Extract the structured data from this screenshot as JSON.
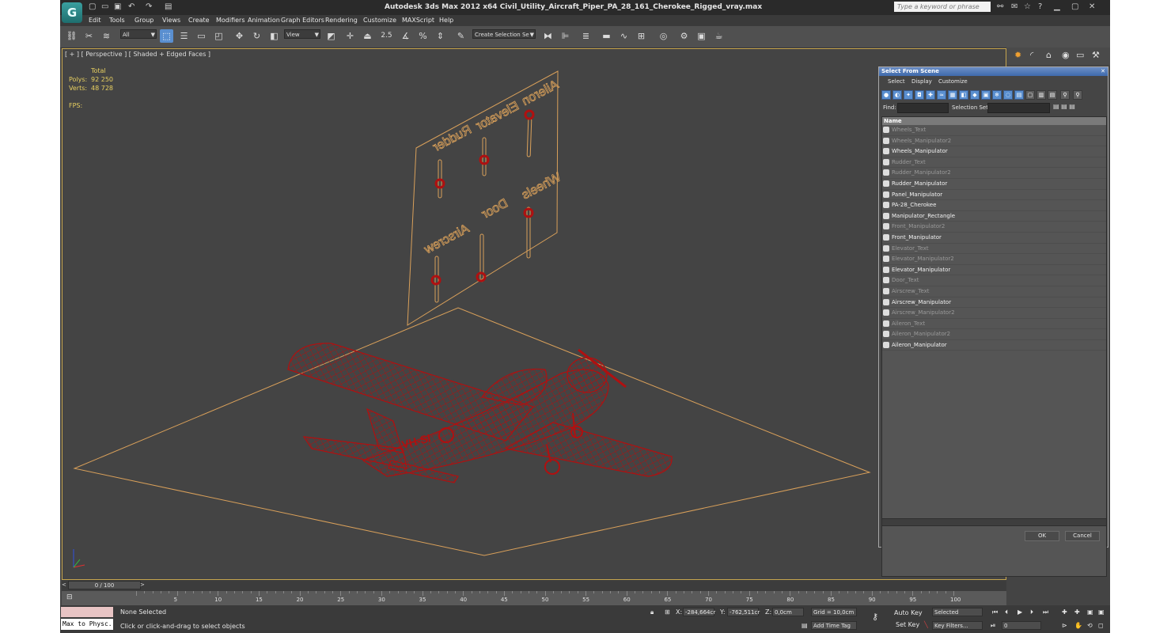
{
  "window": {
    "title": "Autodesk 3ds Max  2012 x64     Civil_Utility_Aircraft_Piper_PA_28_161_Cherokee_Rigged_vray.max",
    "search_placeholder": "Type a keyword or phrase"
  },
  "menu": [
    "Edit",
    "Tools",
    "Group",
    "Views",
    "Create",
    "Modifiers",
    "Animation",
    "Graph Editors",
    "Rendering",
    "Customize",
    "MAXScript",
    "Help"
  ],
  "toolbar": {
    "filter_value": "All",
    "coord_value": "View",
    "selection_set_placeholder": "Create Selection Se",
    "snap_angle_label": "2.5"
  },
  "viewport": {
    "label": "[ + ] [ Perspective ] [ Shaded + Edged Faces ]",
    "stats": {
      "header": "Total",
      "polys_label": "Polys:",
      "polys_value": "92 250",
      "verts_label": "Verts:",
      "verts_value": "48 728",
      "fps_label": "FPS:"
    },
    "panel_labels": [
      "Aileron",
      "Elevator",
      "Rudder",
      "Wheels",
      "Door",
      "Airscrew"
    ],
    "tail_text": "VH-SI"
  },
  "timeline": {
    "slider_label": "0 / 100",
    "ticks": [
      "5",
      "10",
      "15",
      "20",
      "25",
      "30",
      "35",
      "40",
      "45",
      "50",
      "55",
      "60",
      "65",
      "70",
      "75",
      "80",
      "85",
      "90",
      "95",
      "100"
    ]
  },
  "status": {
    "selection": "None Selected",
    "prompt": "Click or click-and-drag to select objects",
    "maxscript": "Max to Physc.",
    "x_label": "X:",
    "x_value": "-284,664cr",
    "y_label": "Y:",
    "y_value": "-762,511cr",
    "z_label": "Z:",
    "z_value": "0,0cm",
    "grid": "Grid = 10,0cm",
    "add_time_tag": "Add Time Tag",
    "auto_key": "Auto Key",
    "set_key": "Set Key",
    "key_mode_value": "Selected",
    "key_filters": "Key Filters...",
    "frame_value": "0"
  },
  "dialog": {
    "title": "Select From Scene",
    "menu": [
      "Select",
      "Display",
      "Customize"
    ],
    "find_label": "Find:",
    "selection_set_label": "Selection Set:",
    "column_header": "Name",
    "items": [
      {
        "name": "Wheels_Text",
        "state": "hidden"
      },
      {
        "name": "Wheels_Manipulator2",
        "state": "hidden"
      },
      {
        "name": "Wheels_Manipulator",
        "state": "visible"
      },
      {
        "name": "Rudder_Text",
        "state": "hidden"
      },
      {
        "name": "Rudder_Manipulator2",
        "state": "hidden"
      },
      {
        "name": "Rudder_Manipulator",
        "state": "visible"
      },
      {
        "name": "Panel_Manipulator",
        "state": "visible"
      },
      {
        "name": "PA-28_Cherokee",
        "state": "visible"
      },
      {
        "name": "Manipulator_Rectangle",
        "state": "visible"
      },
      {
        "name": "Front_Manipulator2",
        "state": "hidden"
      },
      {
        "name": "Front_Manipulator",
        "state": "visible"
      },
      {
        "name": "Elevator_Text",
        "state": "hidden"
      },
      {
        "name": "Elevator_Manipulator2",
        "state": "hidden"
      },
      {
        "name": "Elevator_Manipulator",
        "state": "visible"
      },
      {
        "name": "Door_Text",
        "state": "hidden"
      },
      {
        "name": "Airscrew_Text",
        "state": "hidden"
      },
      {
        "name": "Airscrew_Manipulator",
        "state": "visible"
      },
      {
        "name": "Airscrew_Manipulator2",
        "state": "hidden"
      },
      {
        "name": "Aileron_Text",
        "state": "hidden"
      },
      {
        "name": "Aileron_Manipulator2",
        "state": "hidden"
      },
      {
        "name": "Aileron_Manipulator",
        "state": "visible"
      }
    ],
    "ok_label": "OK",
    "cancel_label": "Cancel"
  },
  "colors": {
    "wire_red": "#b01010",
    "helper_orange": "#d9a05a",
    "stats_yellow": "#e8d060",
    "viewport_border": "#c6a54e"
  }
}
